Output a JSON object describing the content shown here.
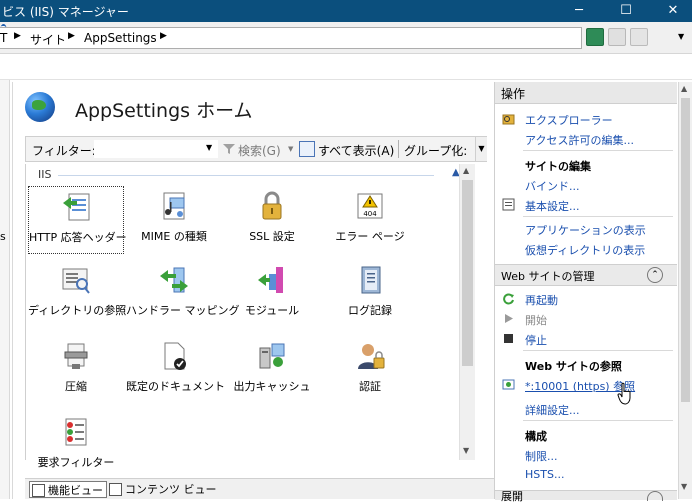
{
  "window": {
    "title": "ビス (IIS) マネージャー",
    "min_glyph": "─",
    "max_glyph": "☐",
    "close_glyph": "✕"
  },
  "address": {
    "crumbs": [
      "T",
      "サイト",
      "AppSettings"
    ],
    "sep": "▶"
  },
  "toolbar": {
    "help": "?",
    "arrow": "▼"
  },
  "page": {
    "title": "AppSettings ホーム",
    "left_dash": "s"
  },
  "filter": {
    "label": "フィルター:",
    "placeholder": "",
    "caret": "▼",
    "search_label": "検索(G)",
    "search_caret": "▼",
    "show_all_label": "すべて表示(A)",
    "group_by_label": "グループ化:",
    "scroll_glyph": "▼"
  },
  "group": {
    "name": "IIS",
    "collapse_glyph": "▲"
  },
  "features": [
    {
      "label": "HTTP 応答ヘッダー",
      "icon": "http-response-headers-icon"
    },
    {
      "label": "MIME の種類",
      "icon": "mime-types-icon"
    },
    {
      "label": "SSL 設定",
      "icon": "ssl-settings-icon"
    },
    {
      "label": "エラー ページ",
      "icon": "error-pages-icon",
      "badge": "404"
    },
    {
      "label": "ディレクトリの参照",
      "icon": "directory-browsing-icon"
    },
    {
      "label": "ハンドラー マッピング",
      "icon": "handler-mappings-icon"
    },
    {
      "label": "モジュール",
      "icon": "modules-icon"
    },
    {
      "label": "ログ記録",
      "icon": "logging-icon"
    },
    {
      "label": "圧縮",
      "icon": "compression-icon"
    },
    {
      "label": "既定のドキュメント",
      "icon": "default-document-icon"
    },
    {
      "label": "出力キャッシュ",
      "icon": "output-caching-icon"
    },
    {
      "label": "認証",
      "icon": "authentication-icon"
    },
    {
      "label": "要求フィルター",
      "icon": "request-filtering-icon"
    }
  ],
  "scroll": {
    "up": "▲",
    "down": "▼"
  },
  "tabs": {
    "features_view": "機能ビュー",
    "content_view": "コンテンツ ビュー"
  },
  "actions": {
    "header": "操作",
    "explore": "エクスプローラー",
    "edit_permissions": "アクセス許可の編集...",
    "edit_site_head": "サイトの編集",
    "bindings": "バインド...",
    "basic_settings": "基本設定...",
    "view_applications": "アプリケーションの表示",
    "view_vdirs": "仮想ディレクトリの表示",
    "manage_section": "Web サイトの管理",
    "collapse_glyph": "⌃",
    "restart": "再起動",
    "start": "開始",
    "stop": "停止",
    "browse_head": "Web サイトの参照",
    "browse_link": "*:10001 (https) 参照",
    "advanced_settings": "詳細設定...",
    "configure_head": "構成",
    "limits": "制限...",
    "hsts": "HSTS...",
    "bottom_section": "展開"
  },
  "colors": {
    "titlebar": "#0b4f7d",
    "link": "#1a4fae"
  }
}
